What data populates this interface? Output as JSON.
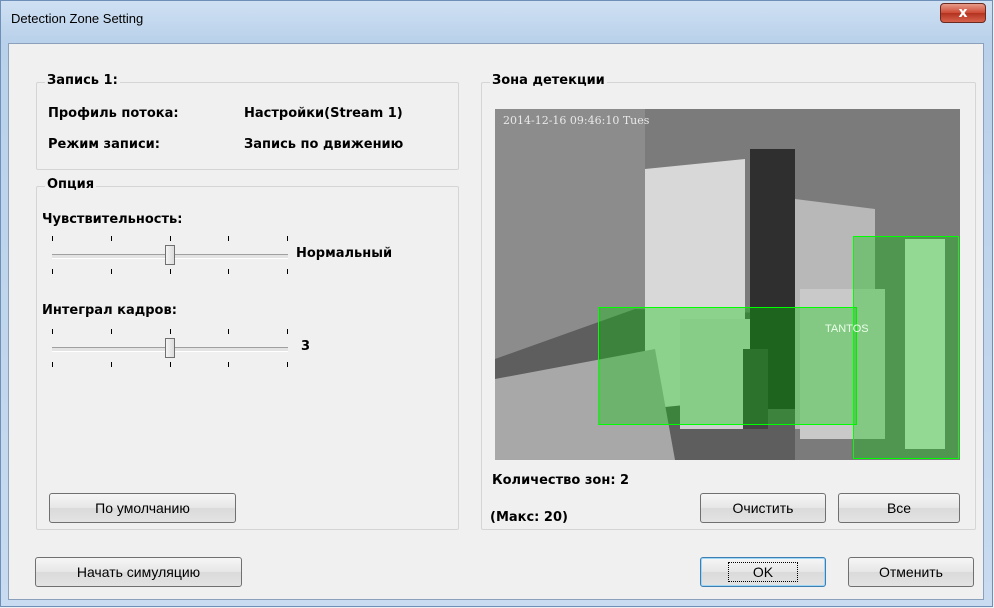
{
  "window": {
    "title": "Detection Zone Setting",
    "close_glyph": "x"
  },
  "record": {
    "legend": "Запись 1:",
    "rows": [
      {
        "label": "Профиль потока:",
        "value": "Настройки(Stream 1)"
      },
      {
        "label": "Режим записи:",
        "value": "Запись по движению"
      }
    ]
  },
  "options": {
    "legend": "Опция",
    "sensitivity": {
      "label": "Чувствительность:",
      "value_label": "Нормальный",
      "level": 0.5
    },
    "frames": {
      "label": "Интеграл кадров:",
      "value_label": "3",
      "level": 0.5
    },
    "default_button": "По умолчанию"
  },
  "zone": {
    "legend": "Зона детекции",
    "timestamp": "2014-12-16 09:46:10 Tues",
    "count_label": "Количество зон: 2",
    "max_label": "(Макс: 20)",
    "clear_button": "Очистить",
    "all_button": "Все",
    "overlay_color": "#00ff00",
    "camera_logo": "TANTOS"
  },
  "footer": {
    "simulate_button": "Начать симуляцию",
    "ok_button": "OK",
    "cancel_button": "Отменить"
  }
}
